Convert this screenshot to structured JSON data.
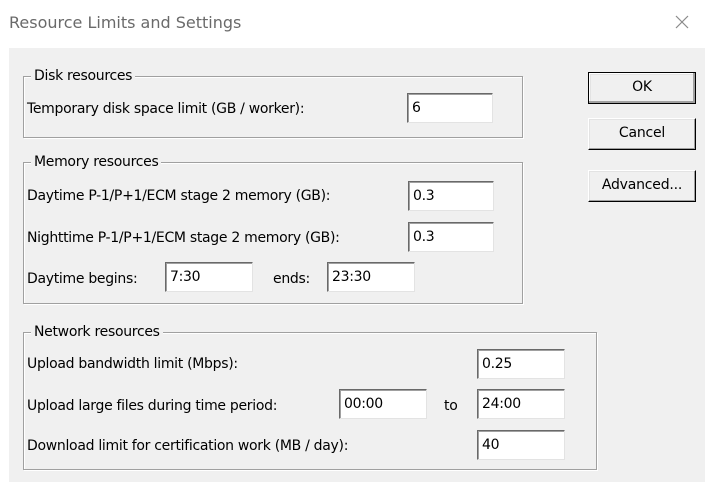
{
  "window": {
    "title": "Resource Limits and Settings"
  },
  "disk": {
    "group_label": "Disk resources",
    "temp_limit_label": "Temporary disk space limit (GB / worker):",
    "temp_limit_value": "6"
  },
  "memory": {
    "group_label": "Memory resources",
    "daytime_label": "Daytime P-1/P+1/ECM stage 2 memory (GB):",
    "daytime_value": "0.3",
    "nighttime_label": "Nighttime P-1/P+1/ECM stage 2 memory (GB):",
    "nighttime_value": "0.3",
    "day_begins_label": "Daytime begins:",
    "day_begins_value": "7:30",
    "ends_label": "ends:",
    "ends_value": "23:30"
  },
  "network": {
    "group_label": "Network resources",
    "upload_bw_label": "Upload bandwidth limit (Mbps):",
    "upload_bw_value": "0.25",
    "upload_period_label": "Upload large files during time period:",
    "upload_from_value": "00:00",
    "to_label": "to",
    "upload_to_value": "24:00",
    "download_label": "Download limit for certification work (MB / day):",
    "download_value": "40"
  },
  "buttons": {
    "ok": "OK",
    "cancel": "Cancel",
    "advanced": "Advanced..."
  },
  "icons": {
    "close": "close-icon"
  }
}
